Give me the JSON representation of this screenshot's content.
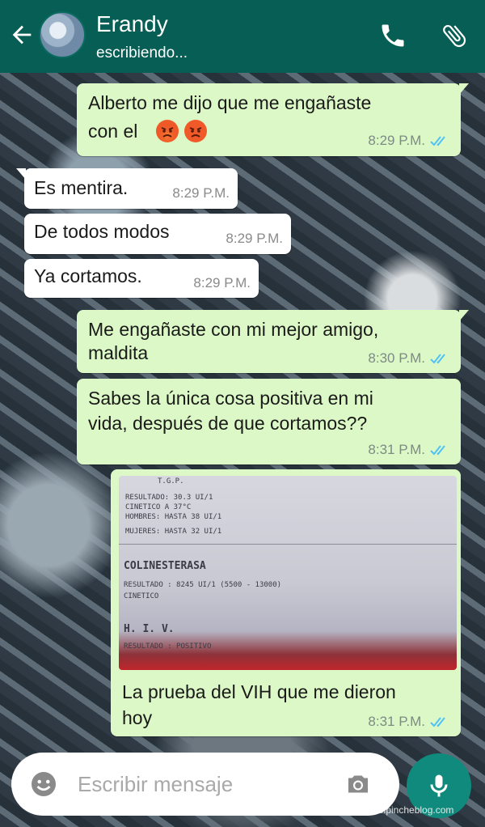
{
  "header": {
    "contact_name": "Erandy",
    "status": "escribiendo...",
    "back_icon": "arrow-left-icon",
    "call_icon": "phone-icon",
    "attach_icon": "paperclip-icon",
    "color": "#075e54"
  },
  "messages": [
    {
      "dir": "out",
      "lines": [
        "Alberto me dijo que me engañaste",
        "con el"
      ],
      "emoji": [
        "angry-face",
        "angry-face"
      ],
      "time": "8:29 P.M.",
      "read": true
    },
    {
      "dir": "in",
      "lines": [
        "Es mentira."
      ],
      "time": "8:29 P.M."
    },
    {
      "dir": "in",
      "lines": [
        "De todos modos"
      ],
      "time": "8:29 P.M."
    },
    {
      "dir": "in",
      "lines": [
        "Ya cortamos."
      ],
      "time": "8:29 P.M."
    },
    {
      "dir": "out",
      "lines": [
        "Me engañaste con mi mejor amigo,",
        "maldita"
      ],
      "time": "8:30 P.M.",
      "read": true
    },
    {
      "dir": "out",
      "lines": [
        "Sabes la única cosa positiva en mi",
        "vida, después de que cortamos??"
      ],
      "time": "8:31 P.M.",
      "read": true
    },
    {
      "dir": "out",
      "type": "image",
      "caption": [
        "La prueba del VIH que me dieron",
        "hoy"
      ],
      "time": "8:31 P.M.",
      "read": true,
      "image_text": {
        "l1": "T.G.P.",
        "l2": "RESULTADO: 30.3 UI/1",
        "l3": "CINETICO A 37°C",
        "l4": "HOMBRES: HASTA 38 UI/1",
        "l5": "MUJERES: HASTA 32 UI/1",
        "l6": "COLINESTERASA",
        "l7": "RESULTADO : 8245 UI/1 (5500 - 13000)",
        "l8": "CINETICO",
        "l9": "H. I. V.",
        "l10": "RESULTADO : POSITIVO"
      }
    }
  ],
  "input": {
    "placeholder": "Escribir mensaje",
    "emoji_icon": "smiley-icon",
    "camera_icon": "camera-icon",
    "mic_icon": "microphone-icon"
  },
  "watermark": "elpincheblog.com",
  "colors": {
    "outgoing": "#dcf8c6",
    "incoming": "#ffffff",
    "read_ticks": "#4fc3f7",
    "accent": "#0f8a7d"
  }
}
